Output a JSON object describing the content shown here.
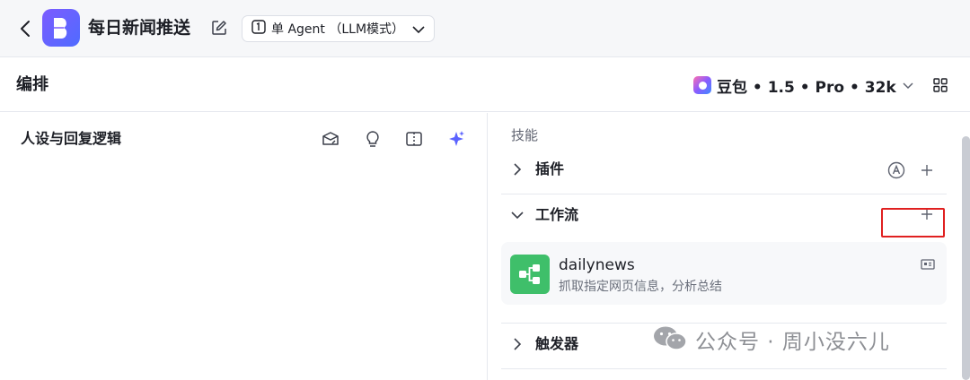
{
  "header": {
    "app_title": "每日新闻推送",
    "mode": "单 Agent （LLM模式）"
  },
  "toolbar": {
    "section_title": "编排",
    "model": "豆包 • 1.5 • Pro • 32k"
  },
  "persona": {
    "title": "人设与回复逻辑"
  },
  "skills": {
    "label": "技能",
    "plugins": {
      "label": "插件"
    },
    "workflow": {
      "label": "工作流",
      "items": [
        {
          "name": "dailynews",
          "description": "抓取指定网页信息，分析总结"
        }
      ]
    },
    "trigger": {
      "label": "触发器"
    }
  },
  "watermark": {
    "text": "公众号 · 周小没六儿"
  },
  "colors": {
    "brand": "#5b63ff",
    "workflow_icon": "#3fbf6a",
    "highlight": "#e02020"
  }
}
